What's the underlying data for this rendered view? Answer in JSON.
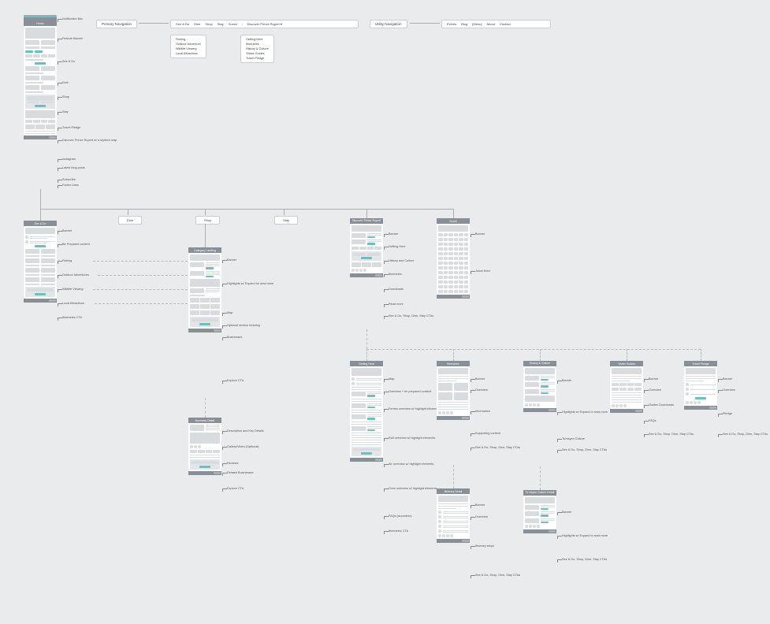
{
  "navigation": {
    "primary_label": "Primary Navigation",
    "utility_label": "Utility Navigation",
    "primary_items": [
      "See & Do",
      "Dine",
      "Shop",
      "Stay",
      "Social",
      "|",
      "Discover Prince Rupert ▾"
    ],
    "utility_items": [
      "Events",
      "Blog",
      "[Menu]",
      "About",
      "Contact"
    ],
    "dropdown_seedo": [
      "Fishing",
      "Outdoor Adventure",
      "Wildlife Viewing",
      "Local Attractions"
    ],
    "dropdown_discover": [
      "Getting Here",
      "Itineraries",
      "History & Culture",
      "Visitor Guides",
      "Travel Pledge"
    ]
  },
  "categories": {
    "dine": "Dine",
    "shop": "Shop",
    "stay": "Stay"
  },
  "cards": {
    "home": {
      "title": "Home",
      "annots": [
        "Notification Bar",
        "Feature Banner",
        "See & Do",
        "Dine",
        "Shop",
        "Stay",
        "Travel Pledge",
        "Discover Prince Rupert w/ a stylized map",
        "Instagram",
        "Latest blog posts",
        "Subscribe",
        "Footer Links"
      ]
    },
    "seedo": {
      "title": "See & Do",
      "annots": [
        "Banner",
        "Be Prepared content",
        "Fishing",
        "Outdoor Adventures",
        "Wildlife Viewing",
        "Local Attractions",
        "Itineraries CTA"
      ]
    },
    "category": {
      "title": "Category Landing",
      "annots": [
        "Banner",
        "Highlights w/ Expand for read more",
        "Map",
        "Optional section heading",
        "Businesses",
        "Explore CTA"
      ]
    },
    "business": {
      "title": "Business Detail",
      "annots": [
        "Description and Key Details",
        "Gallery/Video (Optional)",
        "Reviews",
        "Related Businesses",
        "Explore CTA"
      ]
    },
    "discover": {
      "title": "Discover Prince Rupert",
      "annots": [
        "Banner",
        "Getting Here",
        "History and Culture",
        "Itineraries",
        "Downloads",
        "Read more",
        "See & Do, Shop, Dine, Stay CTAs"
      ]
    },
    "social": {
      "title": "Social",
      "annots": [
        "Banner",
        "Juicer feed"
      ]
    },
    "gettinghere": {
      "title": "Getting Here",
      "annots": [
        "Map",
        "Overview + be prepared content",
        "Ferries overview w/ highlight elements",
        "Rail overview w/ highlight elements",
        "Air overview w/ highlight elements",
        "Drive overview w/ highlight elements",
        "FAQs (accordion)",
        "Itineraries CTA"
      ]
    },
    "itineraries": {
      "title": "Itineraries",
      "annots": [
        "Banner",
        "Overview",
        "Information",
        "Supporting content",
        "See & Do, Shop, Dine, Stay CTAs"
      ]
    },
    "itinerarydetail": {
      "title": "Itinerary Detail",
      "annots": [
        "Banner",
        "Overview",
        "Itinerary steps",
        "See & Do, Shop, Dine, Stay CTAs"
      ]
    },
    "history": {
      "title": "History & Culture",
      "annots": [
        "Banner",
        "Highlights w/ Expand to read more",
        "Ts'msyen Culture",
        "See & Do, Shop, Dine, Stay CTAs"
      ]
    },
    "tsmsyen": {
      "title": "Ts'msyen Culture Detail",
      "annots": [
        "Banner",
        "Highlights w/ Expand to read more",
        "See & Do, Shop, Dine, Stay CTAs"
      ]
    },
    "guides": {
      "title": "Visitor Guides",
      "annots": [
        "Banner",
        "Overview",
        "Guides Downloads",
        "FAQs",
        "See & Do, Shop, Dine, Stay CTAs"
      ]
    },
    "pledge": {
      "title": "Travel Pledge",
      "annots": [
        "Banner",
        "Overview",
        "Pledge",
        "See & Do, Shop, Dine, Stay CTAs"
      ]
    }
  }
}
